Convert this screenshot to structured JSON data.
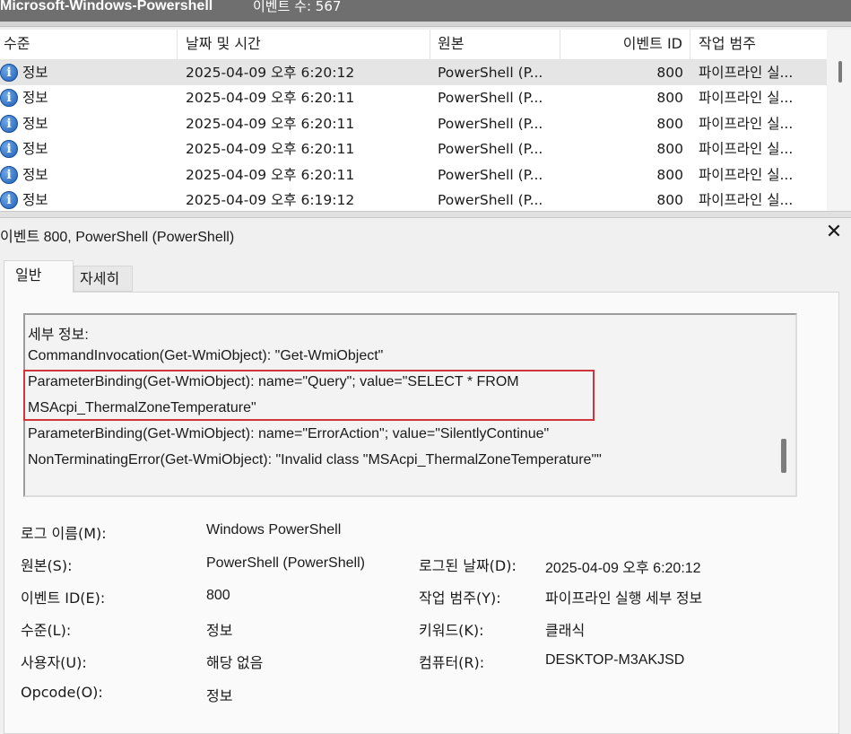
{
  "topbar": {
    "log_name": "Microsoft-Windows-Powershell",
    "event_count": "이벤트 수: 567"
  },
  "grid": {
    "columns": [
      "수준",
      "날짜 및 시간",
      "원본",
      "이벤트 ID",
      "작업 범주"
    ],
    "rows": [
      {
        "level": "정보",
        "datetime": "2025-04-09 오후 6:20:12",
        "source": "PowerShell (P...",
        "event_id": "800",
        "category": "파이프라인 실..."
      },
      {
        "level": "정보",
        "datetime": "2025-04-09 오후 6:20:11",
        "source": "PowerShell (P...",
        "event_id": "800",
        "category": "파이프라인 실..."
      },
      {
        "level": "정보",
        "datetime": "2025-04-09 오후 6:20:11",
        "source": "PowerShell (P...",
        "event_id": "800",
        "category": "파이프라인 실..."
      },
      {
        "level": "정보",
        "datetime": "2025-04-09 오후 6:20:11",
        "source": "PowerShell (P...",
        "event_id": "800",
        "category": "파이프라인 실..."
      },
      {
        "level": "정보",
        "datetime": "2025-04-09 오후 6:20:11",
        "source": "PowerShell (P...",
        "event_id": "800",
        "category": "파이프라인 실..."
      },
      {
        "level": "정보",
        "datetime": "2025-04-09 오후 6:19:12",
        "source": "PowerShell (P...",
        "event_id": "800",
        "category": "파이프라인 실..."
      }
    ]
  },
  "detail": {
    "title": "이벤트 800, PowerShell (PowerShell)",
    "tabs": [
      "일반",
      "자세히"
    ],
    "message_lines": [
      "세부 정보:",
      "CommandInvocation(Get-WmiObject): \"Get-WmiObject\"",
      "ParameterBinding(Get-WmiObject): name=\"Query\"; value=\"SELECT * FROM",
      "MSAcpi_ThermalZoneTemperature\"",
      "ParameterBinding(Get-WmiObject): name=\"ErrorAction\"; value=\"SilentlyContinue\"",
      "NonTerminatingError(Get-WmiObject): \"Invalid class \"MSAcpi_ThermalZoneTemperature\"\""
    ],
    "props": {
      "log_name_label": "로그 이름(M):",
      "log_name": "Windows PowerShell",
      "source_label": "원본(S):",
      "source": "PowerShell (PowerShell)",
      "logged_label": "로그된 날짜(D):",
      "logged": "2025-04-09 오후 6:20:12",
      "event_id_label": "이벤트 ID(E):",
      "event_id": "800",
      "task_label": "작업 범주(Y):",
      "task": "파이프라인 실행 세부 정보",
      "level_label": "수준(L):",
      "level": "정보",
      "keywords_label": "키워드(K):",
      "keywords": "클래식",
      "user_label": "사용자(U):",
      "user": "해당 없음",
      "computer_label": "컴퓨터(R):",
      "computer": "DESKTOP-M3AKJSD",
      "opcode_label": "Opcode(O):",
      "opcode": "정보"
    }
  },
  "icons": {
    "level_icon": "information-icon",
    "close": "close-icon"
  },
  "colors": {
    "highlight_border": "#d0343c",
    "info_icon": "#1f5fb4"
  }
}
